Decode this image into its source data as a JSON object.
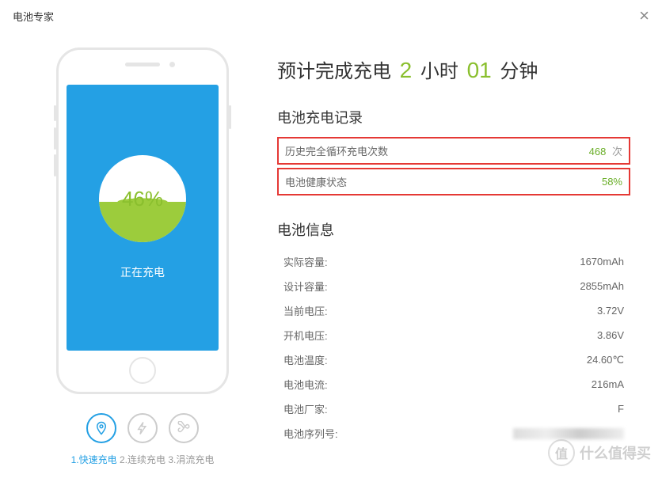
{
  "app_title": "电池专家",
  "phone": {
    "percent": "46%",
    "status": "正在充电"
  },
  "modes": [
    {
      "n": "1",
      "label": "快速充电",
      "active": true
    },
    {
      "n": "2",
      "label": "连续充电",
      "active": false
    },
    {
      "n": "3",
      "label": "涓流充电",
      "active": false
    }
  ],
  "estimate": {
    "prefix": "预计完成充电",
    "hours": "2",
    "hours_unit": "小时",
    "mins": "01",
    "mins_unit": "分钟"
  },
  "charge_record": {
    "title": "电池充电记录",
    "cycle_label": "历史完全循环充电次数",
    "cycle_value": "468",
    "cycle_unit": "次",
    "health_label": "电池健康状态",
    "health_value": "58%"
  },
  "battery_info": {
    "title": "电池信息",
    "rows": [
      {
        "label": "实际容量:",
        "value": "1670mAh"
      },
      {
        "label": "设计容量:",
        "value": "2855mAh"
      },
      {
        "label": "当前电压:",
        "value": "3.72V"
      },
      {
        "label": "开机电压:",
        "value": "3.86V"
      },
      {
        "label": "电池温度:",
        "value": "24.60℃"
      },
      {
        "label": "电池电流:",
        "value": "216mA"
      },
      {
        "label": "电池厂家:",
        "value": "F"
      },
      {
        "label": "电池序列号:",
        "value": ""
      }
    ]
  },
  "watermark": {
    "icon": "值",
    "text": "什么值得买"
  }
}
